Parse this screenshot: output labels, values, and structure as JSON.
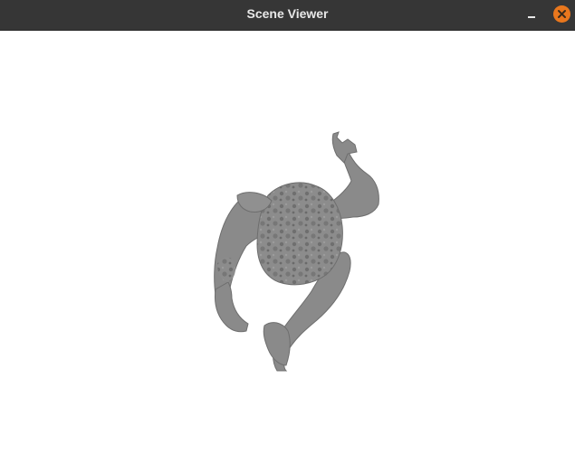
{
  "window": {
    "title": "Scene Viewer"
  },
  "controls": {
    "minimize_icon": "minimize-icon",
    "close_icon": "close-icon"
  },
  "colors": {
    "titlebar": "#363636",
    "title_text": "#e8e8e8",
    "close_button": "#e9771d",
    "viewport_background": "#ffffff",
    "mesh": "#8a8a8a"
  }
}
